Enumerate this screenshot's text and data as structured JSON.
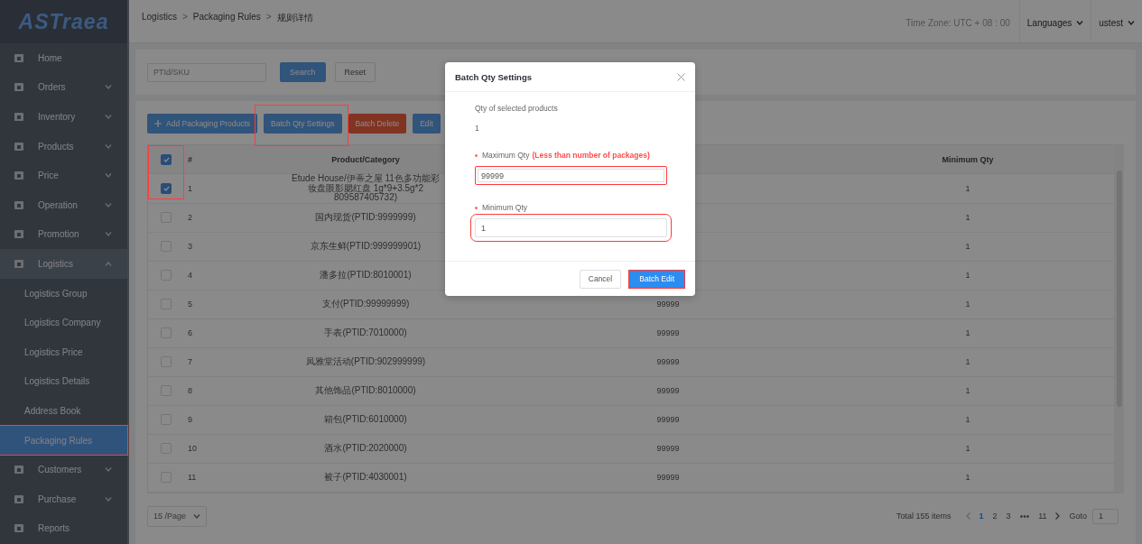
{
  "logo": {
    "text": "ASTraea"
  },
  "sidebar": {
    "items": [
      {
        "label": "Home",
        "kind": "link"
      },
      {
        "label": "Orders",
        "kind": "group",
        "expanded": false
      },
      {
        "label": "Inventory",
        "kind": "group",
        "expanded": false
      },
      {
        "label": "Products",
        "kind": "group",
        "expanded": false
      },
      {
        "label": "Price",
        "kind": "group",
        "expanded": false
      },
      {
        "label": "Operation",
        "kind": "group",
        "expanded": false
      },
      {
        "label": "Promotion",
        "kind": "group",
        "expanded": false
      },
      {
        "label": "Logistics",
        "kind": "group",
        "expanded": true,
        "children": [
          {
            "label": "Logistics Group",
            "selected": false,
            "annotated": false
          },
          {
            "label": "Logistics Company",
            "selected": false,
            "annotated": false
          },
          {
            "label": "Logistics Price",
            "selected": false,
            "annotated": false
          },
          {
            "label": "Logistics Details",
            "selected": false,
            "annotated": false
          },
          {
            "label": "Address Book",
            "selected": false,
            "annotated": false
          },
          {
            "label": "Packaging Rules",
            "selected": true,
            "annotated": true
          }
        ]
      },
      {
        "label": "Customers",
        "kind": "group",
        "expanded": false
      },
      {
        "label": "Purchase",
        "kind": "group",
        "expanded": false
      },
      {
        "label": "Reports",
        "kind": "link"
      }
    ]
  },
  "header": {
    "breadcrumb": [
      "Logistics",
      "Packaging Rules",
      "规则详情"
    ],
    "separator": ">",
    "timezone": "Time Zone: UTC + 08 : 00",
    "language": "Languages",
    "user": "ustest"
  },
  "filter": {
    "placeholder": "PTId/SKU",
    "buttons": [
      {
        "label": "Search",
        "kind": "primary"
      },
      {
        "label": "Reset",
        "kind": "default"
      }
    ]
  },
  "toolbar": {
    "buttons": [
      {
        "label": "Add Packaging Products",
        "kind": "add",
        "annotated": false
      },
      {
        "label": "Batch Qty Settings",
        "kind": "primary",
        "annotated": true
      },
      {
        "label": "Batch Delete",
        "kind": "danger",
        "annotated": false
      },
      {
        "label": "Edit",
        "kind": "primary",
        "annotated": false
      }
    ]
  },
  "table": {
    "select_all_checked": true,
    "select_column_annotated": true,
    "columns": {
      "index": "#",
      "product": "Product/Category",
      "min_qty": "Minimum Qty"
    },
    "rows": [
      {
        "checked": true,
        "index": "1",
        "product": "Etude House/伊蒂之屋 11色多功能彩妆盘眼影腮红盘 1g*9+3.5g*2 809587405732)",
        "min_qty": "1"
      },
      {
        "checked": false,
        "index": "2",
        "product": "国内现货(PTID:9999999)",
        "min_qty": "1"
      },
      {
        "checked": false,
        "index": "3",
        "product": "京东生鲜(PTID:999999901)",
        "min_qty": "1"
      },
      {
        "checked": false,
        "index": "4",
        "product": "潘多拉(PTID:8010001)",
        "min_qty": "1"
      },
      {
        "checked": false,
        "index": "5",
        "product": "支付(PTID:99999999)",
        "column_4": "99999",
        "min_qty": "1"
      },
      {
        "checked": false,
        "index": "6",
        "product": "手表(PTID:7010000)",
        "column_4": "99999",
        "min_qty": "1"
      },
      {
        "checked": false,
        "index": "7",
        "product": "凤雅堂活动(PTID:902999999)",
        "column_4": "99999",
        "min_qty": "1"
      },
      {
        "checked": false,
        "index": "8",
        "product": "其他饰品(PTID:8010000)",
        "column_4": "99999",
        "min_qty": "1"
      },
      {
        "checked": false,
        "index": "9",
        "product": "箱包(PTID:6010000)",
        "column_4": "99999",
        "min_qty": "1"
      },
      {
        "checked": false,
        "index": "10",
        "product": "酒水(PTID:2020000)",
        "column_4": "99999",
        "min_qty": "1"
      },
      {
        "checked": false,
        "index": "11",
        "product": "被子(PTID:4030001)",
        "column_4": "99999",
        "min_qty": "1"
      }
    ]
  },
  "pagination": {
    "page_size": "15 /Page",
    "total": "Total 155 items",
    "pages": [
      {
        "label": "1",
        "kind": "page",
        "selected": true
      },
      {
        "label": "2",
        "kind": "page",
        "selected": false
      },
      {
        "label": "3",
        "kind": "page",
        "selected": false
      },
      {
        "label": "•••",
        "kind": "ellipsis"
      },
      {
        "label": "11",
        "kind": "page",
        "selected": false
      }
    ],
    "goto_label": "Goto",
    "goto_value": "1"
  },
  "modal": {
    "title": "Batch Qty Settings",
    "count_label": "Qty of selected products",
    "count": "1",
    "fields": [
      {
        "label": "Maximum Qty",
        "hint": "(Less than number of packages)",
        "required": true,
        "value": "99999",
        "annotated": true
      },
      {
        "label": "Minimum Qty",
        "required": true,
        "value": "1",
        "annotated": true
      }
    ],
    "buttons": [
      {
        "label": "Cancel",
        "kind": "default",
        "annotated": false
      },
      {
        "label": "Batch Edit",
        "kind": "primary",
        "annotated": true
      }
    ]
  }
}
